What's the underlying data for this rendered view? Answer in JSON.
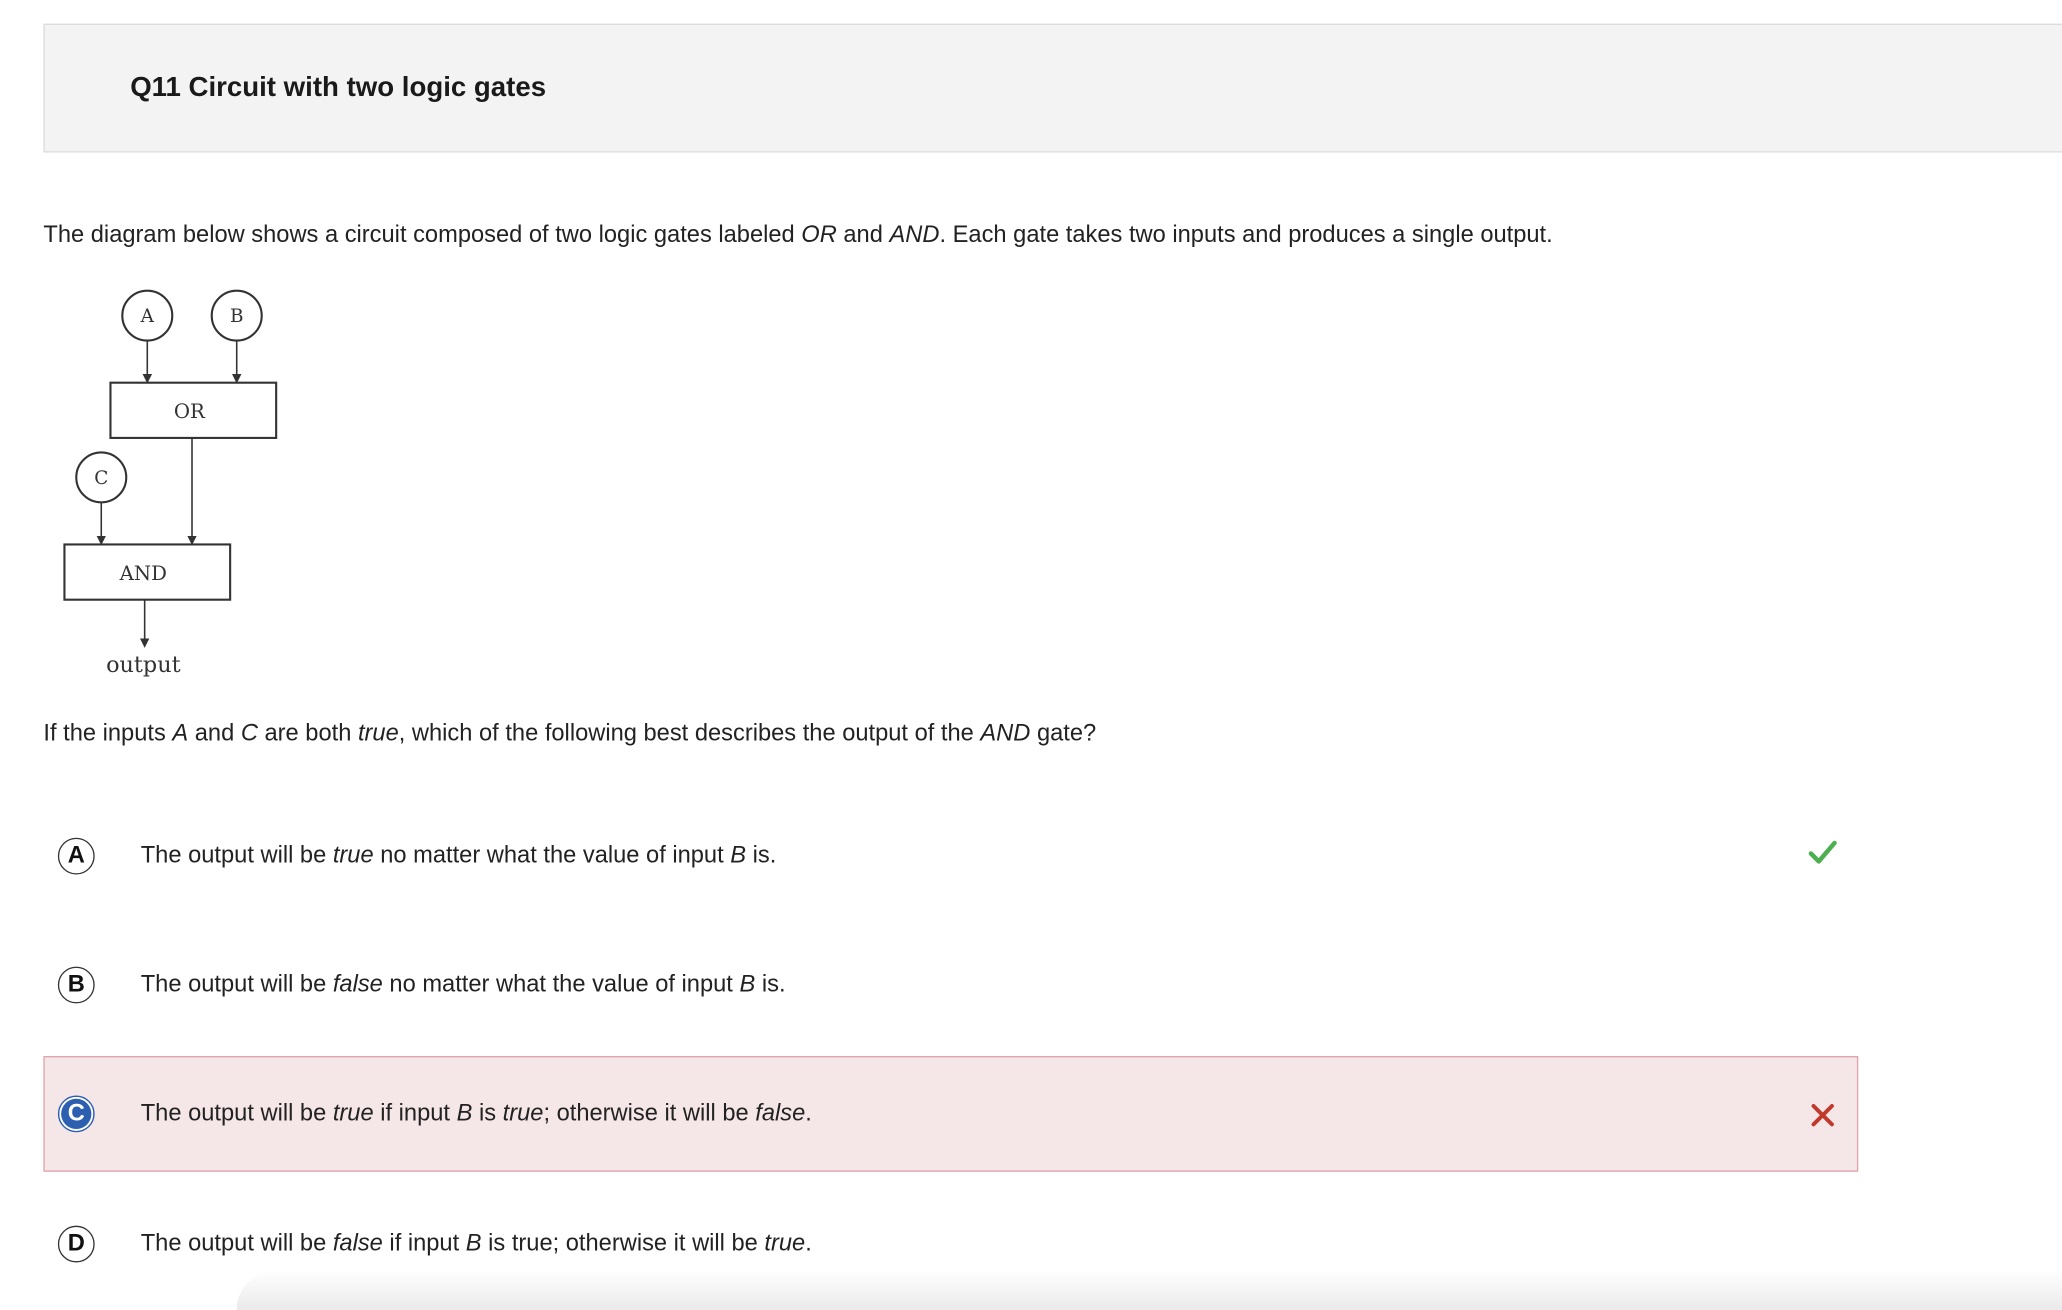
{
  "header": {
    "title": "Q11 Circuit with two logic gates"
  },
  "intro": {
    "p1": "The diagram below shows a circuit composed of two logic gates labeled ",
    "or": "OR",
    "p2": " and ",
    "and": "AND",
    "p3": ". Each gate takes two inputs and produces a single output."
  },
  "diagram": {
    "input_a": "A",
    "input_b": "B",
    "input_c": "C",
    "gate_or": "OR",
    "gate_and": "AND",
    "output_label": "output"
  },
  "question": {
    "p1": "If the inputs ",
    "a": "A",
    "p2": " and ",
    "c": "C",
    "p3": " are both ",
    "true": "true",
    "p4": ", which of the following best describes the output of the ",
    "and": "AND",
    "p5": " gate?"
  },
  "options": [
    {
      "letter": "A",
      "status": "correct",
      "t1": "The output will be ",
      "e1": "true",
      "t2": " no matter what the value of input ",
      "e2": "B",
      "t3": " is."
    },
    {
      "letter": "B",
      "status": "none",
      "t1": "The output will be ",
      "e1": "false",
      "t2": " no matter what the value of input ",
      "e2": "B",
      "t3": " is."
    },
    {
      "letter": "C",
      "status": "incorrect-selected",
      "t1": "The output will be ",
      "e1": "true",
      "t2": " if input ",
      "e2": "B",
      "t3": " is ",
      "e3": "true",
      "t4": "; otherwise it will be ",
      "e4": "false",
      "t5": "."
    },
    {
      "letter": "D",
      "status": "none",
      "t1": "The output will be ",
      "e1": "false",
      "t2": " if input ",
      "e2": "B",
      "t3": " is true; otherwise it will be ",
      "e3": "true",
      "t4": "."
    }
  ],
  "icons": {
    "correct": "checkmark-icon",
    "incorrect": "x-mark-icon"
  },
  "colors": {
    "correct_green": "#4caf50",
    "incorrect_red": "#c0392b",
    "incorrect_bg": "#f5e6e8",
    "incorrect_border": "#e0a3ab",
    "selected_blue": "#2c5fb0"
  }
}
